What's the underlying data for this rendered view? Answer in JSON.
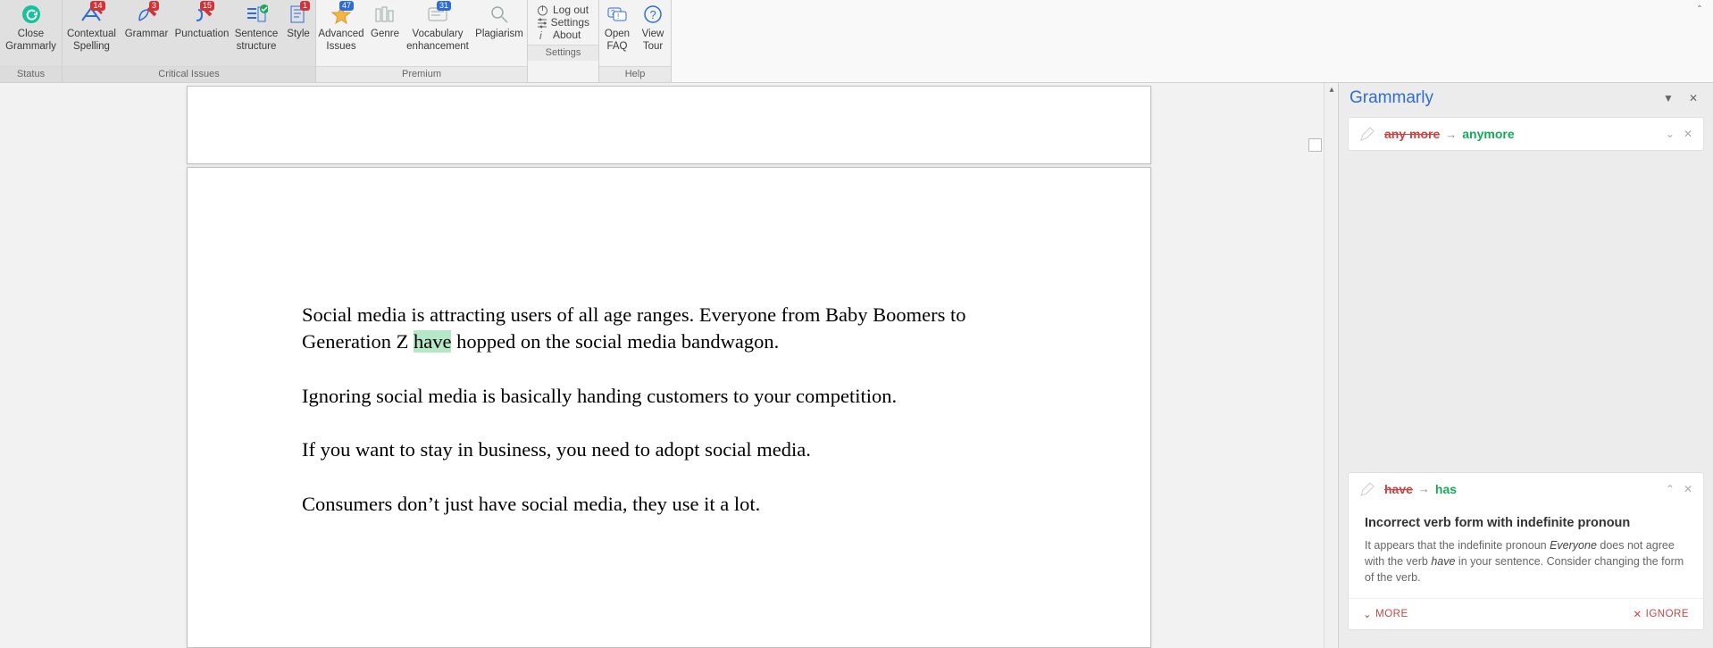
{
  "toolbar": {
    "status": {
      "close_l1": "Close",
      "close_l2": "Grammarly",
      "group": "Status"
    },
    "critical": {
      "contextual_l1": "Contextual",
      "contextual_l2": "Spelling",
      "contextual_badge": "14",
      "grammar": "Grammar",
      "grammar_badge": "3",
      "punct": "Punctuation",
      "punct_badge": "15",
      "sentence_l1": "Sentence",
      "sentence_l2": "structure",
      "style": "Style",
      "style_badge": "1",
      "group": "Critical Issues"
    },
    "premium": {
      "adv_l1": "Advanced",
      "adv_l2": "Issues",
      "adv_badge": "47",
      "genre": "Genre",
      "vocab_l1": "Vocabulary",
      "vocab_l2": "enhancement",
      "vocab_badge": "31",
      "plag": "Plagiarism",
      "group": "Premium"
    },
    "settings": {
      "logout": "Log out",
      "settings": "Settings",
      "about": "About",
      "group": "Settings"
    },
    "help": {
      "open_l1": "Open",
      "open_l2": "FAQ",
      "view_l1": "View",
      "view_l2": "Tour",
      "group": "Help"
    }
  },
  "document": {
    "p1_a": "Social media is attracting users of all age ranges. Everyone from Baby Boomers to Generation Z ",
    "p1_hl": "have",
    "p1_b": " hopped on the social media bandwagon.",
    "p2": "Ignoring social media is basically handing customers to your competition.",
    "p3": "If you want to stay in business,  you need to adopt social media.",
    "p4": "Consumers don’t just have social media, they use it a lot."
  },
  "panel": {
    "title": "Grammarly",
    "card1": {
      "from": "any more",
      "to": "anymore"
    },
    "card2": {
      "from": "have",
      "to": "has",
      "heading": "Incorrect verb form with indefinite pronoun",
      "exp_a": "It appears that the indefinite pronoun ",
      "exp_i1": "Everyone",
      "exp_b": " does not agree with the verb ",
      "exp_i2": "have",
      "exp_c": " in your sentence. Consider changing the form of the verb.",
      "more": "MORE",
      "ignore": "IGNORE"
    }
  }
}
